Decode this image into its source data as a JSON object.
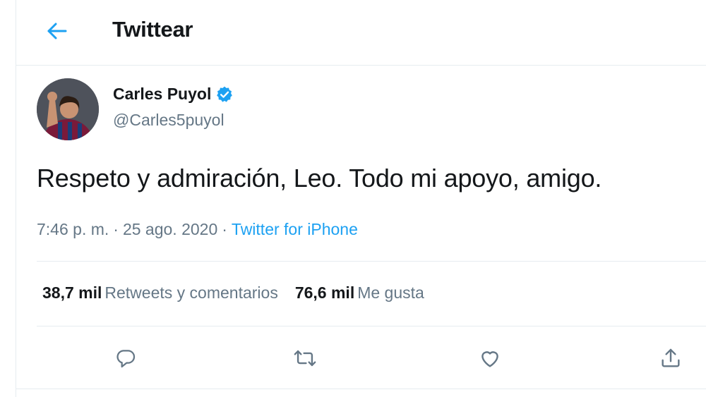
{
  "header": {
    "title": "Twittear",
    "back_icon": "arrow-left-icon"
  },
  "tweet": {
    "author": {
      "name": "Carles Puyol",
      "handle": "@Carles5puyol",
      "verified": true
    },
    "text": "Respeto y admiración, Leo. Todo mi apoyo, amigo.",
    "time": "7:46 p. m.",
    "date": "25 ago. 2020",
    "separator": "·",
    "source": "Twitter for iPhone",
    "stats": {
      "retweets_count": "38,7 mil",
      "retweets_label": "Retweets y comentarios",
      "likes_count": "76,6 mil",
      "likes_label": "Me gusta"
    },
    "actions": [
      "reply-icon",
      "retweet-icon",
      "like-icon",
      "share-icon"
    ]
  },
  "colors": {
    "accent": "#1da1f2",
    "text": "#14171a",
    "secondary": "#657786",
    "border": "#e6ecf0"
  }
}
